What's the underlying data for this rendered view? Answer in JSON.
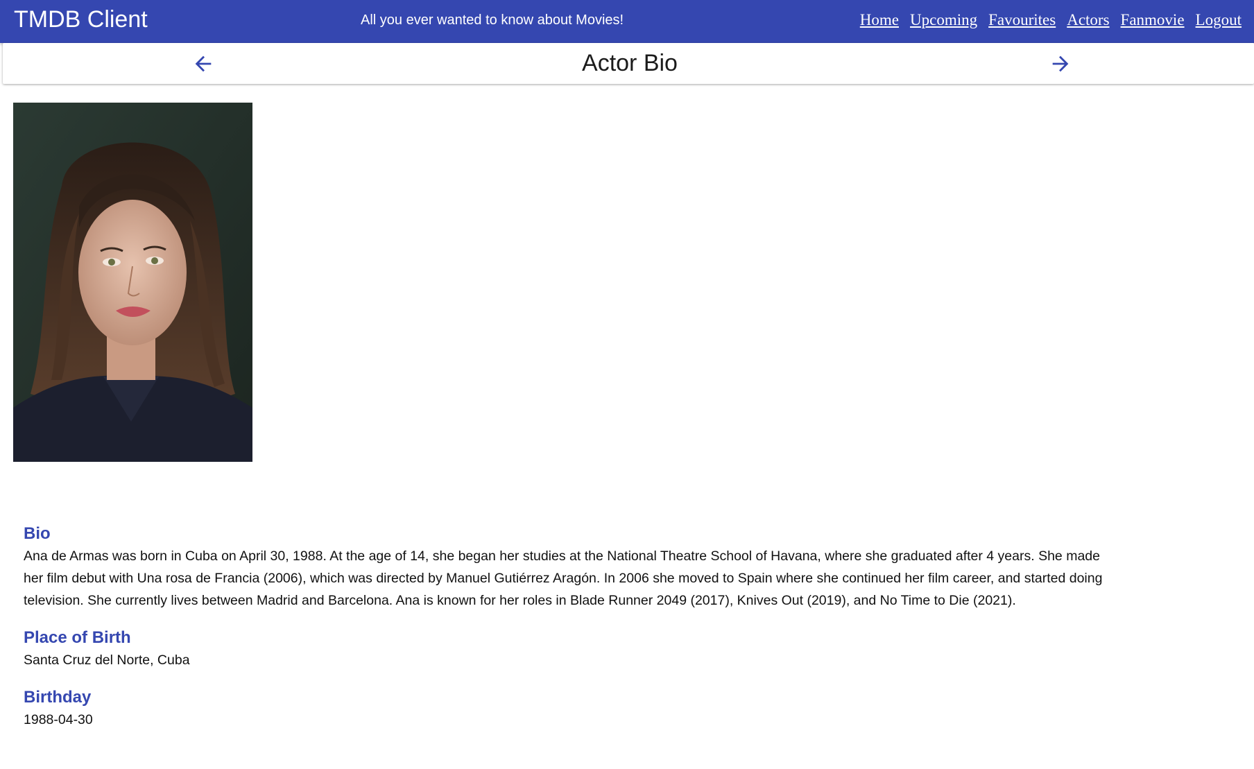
{
  "appbar": {
    "brand": "TMDB Client",
    "tagline": "All you ever wanted to know about Movies!",
    "background_color": "#3547b0",
    "nav": [
      {
        "label": "Home"
      },
      {
        "label": "Upcoming"
      },
      {
        "label": "Favourites"
      },
      {
        "label": "Actors"
      },
      {
        "label": "Fanmovie"
      },
      {
        "label": "Logout"
      }
    ]
  },
  "subheader": {
    "title": "Actor Bio",
    "back_icon": "arrow-left-icon",
    "forward_icon": "arrow-right-icon",
    "icon_color": "#3547b0"
  },
  "actor": {
    "photo": "actor-portrait",
    "sections": {
      "bio": {
        "heading": "Bio",
        "text": "Ana de Armas was born in Cuba on April 30, 1988. At the age of 14, she began her studies at the National Theatre School of Havana, where she graduated after 4 years. She made her film debut with Una rosa de Francia (2006), which was directed by Manuel Gutiérrez Aragón. In 2006 she moved to Spain where she continued her film career, and started doing television. She currently lives between Madrid and Barcelona. Ana is known for her roles in Blade Runner 2049 (2017), Knives Out (2019), and No Time to Die (2021)."
      },
      "place_of_birth": {
        "heading": "Place of Birth",
        "text": "Santa Cruz del Norte, Cuba"
      },
      "birthday": {
        "heading": "Birthday",
        "text": "1988-04-30"
      }
    },
    "heading_color": "#3547b0"
  }
}
